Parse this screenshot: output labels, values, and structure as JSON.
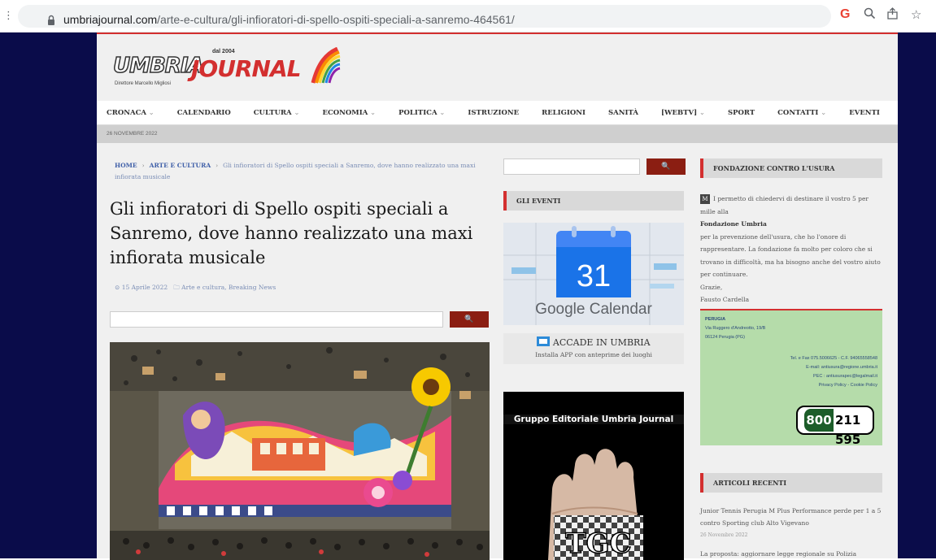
{
  "browser": {
    "url_host": "umbriajournal.com",
    "url_path": "/arte-e-cultura/gli-infioratori-di-spello-ospiti-speciali-a-sanremo-464561/",
    "g_label": "G"
  },
  "header": {
    "logo_umbria": "UMBRIA",
    "logo_journal": "JOURNAL",
    "logo_since": "dal 2004",
    "logo_tagline": "Direttore Marcello Migliosi"
  },
  "nav": {
    "items": [
      {
        "label": "CRONACA",
        "dropdown": true
      },
      {
        "label": "CALENDARIO",
        "dropdown": false
      },
      {
        "label": "CULTURA",
        "dropdown": true
      },
      {
        "label": "ECONOMIA",
        "dropdown": true
      },
      {
        "label": "POLITICA",
        "dropdown": true
      },
      {
        "label": "ISTRUZIONE",
        "dropdown": false
      },
      {
        "label": "RELIGIONI",
        "dropdown": false
      },
      {
        "label": "SANITÀ",
        "dropdown": false
      },
      {
        "label": "[WEBTV]",
        "dropdown": true
      },
      {
        "label": "SPORT",
        "dropdown": false
      },
      {
        "label": "CONTATTI",
        "dropdown": true
      },
      {
        "label": "EVENTI",
        "dropdown": false
      }
    ]
  },
  "datebar": {
    "date": "26 NOVEMBRE 2022"
  },
  "breadcrumb": {
    "home": "HOME",
    "section": "ARTE E CULTURA",
    "current": "Gli infioratori di Spello ospiti speciali a Sanremo, dove hanno realizzato una maxi infiorata musicale"
  },
  "article": {
    "title": "Gli infioratori di Spello ospiti speciali a Sanremo, dove hanno realizzato una maxi infiorata musicale",
    "date": "15 Aprile 2022",
    "categories": "Arte e cultura, Breaking News"
  },
  "search": {
    "button_icon": "search-icon",
    "glyph": "🔍"
  },
  "middle": {
    "events_head": "GLI EVENTI",
    "gcal_day": "31",
    "gcal_text": "Google Calendar",
    "accade_title": "ACCADE IN UMBRIA",
    "accade_sub": "Installa APP con anteprime dei luoghi",
    "gruppo_title": "Gruppo Editoriale Umbria Journal",
    "gruppo_card": "TGC"
  },
  "right": {
    "fond_head": "FONDAZIONE CONTRO L'USURA",
    "fond_line1": "I permetto di chiedervi di destinare il vostro 5 per mille alla",
    "fond_name": "Fondazione Umbria",
    "fond_body": "per la prevenzione dell'usura, che ho l'onore di rappresentare. La fondazione fa molto per coloro che si trovano in difficoltà, ma ha bisogno anche del vostro aiuto per continuare.",
    "fond_thanks": "Grazie,",
    "fond_sign": "Fausto Cardella",
    "green": {
      "city": "PERUGIA",
      "addr1": "Via Ruggero d'Andreotto, 19/B",
      "addr2": "06124 Perugia (PG)",
      "tel": "Tel. e Fax 075.5006625 - C.F. 94065558548",
      "email": "E-mail: antiusura@regione.umbria.it",
      "pec": "PEC : antiusurapec@legalmail.it",
      "privacy": "Privacy Policy - Cookie Policy",
      "phone_prefix": "800",
      "phone_number": "211 595"
    },
    "recent_head": "ARTICOLI RECENTI",
    "recent": [
      {
        "title": "Junior Tennis Perugia M Plus Performance perde per 1 a 5 contro Sporting club Alto Vigevano",
        "date": "26 Novembre 2022"
      },
      {
        "title": "La proposta: aggiornare legge regionale su Polizia",
        "date": ""
      }
    ]
  },
  "colors": {
    "navy": "#0a0c4a",
    "accent_red": "#d32f2f",
    "button_red": "#8b1e12",
    "green": "#b5dcaa"
  }
}
